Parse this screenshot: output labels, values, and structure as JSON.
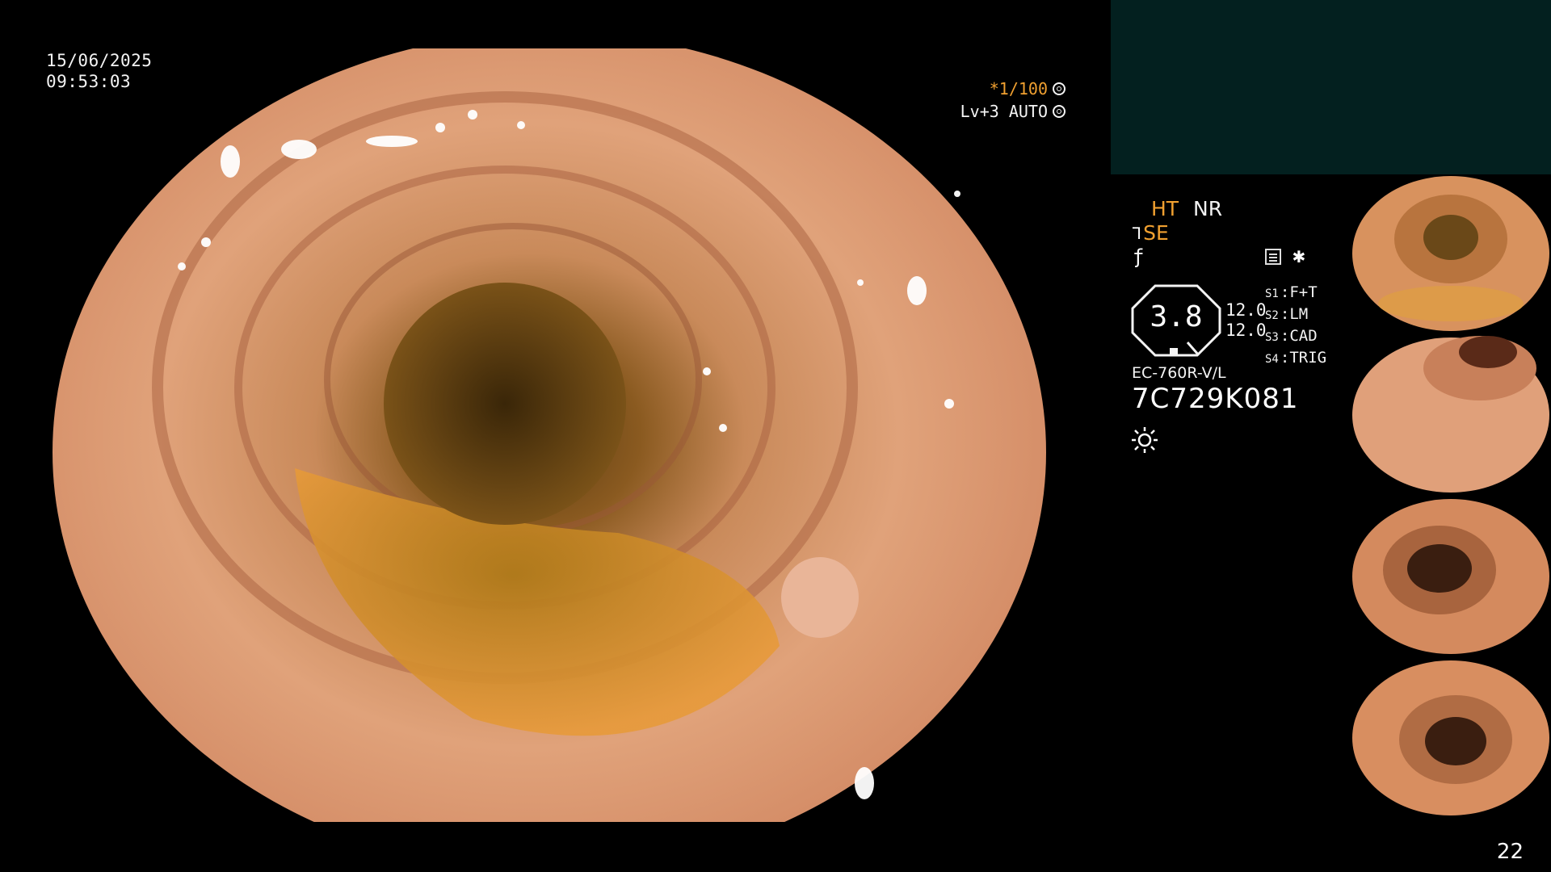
{
  "overlay": {
    "date": "15/06/2025",
    "time": "09:53:03",
    "shutter": "*1/100",
    "level": "Lv+3 AUTO"
  },
  "panel": {
    "ht": "HT",
    "nr": "NR",
    "se": "SE",
    "zoom": "3.8",
    "num1": "12.0",
    "num2": "12.0",
    "slots": [
      {
        "key": "S1",
        "value": "F+T"
      },
      {
        "key": "S2",
        "value": "LM"
      },
      {
        "key": "S3",
        "value": "CAD"
      },
      {
        "key": "S4",
        "value": "TRIG"
      }
    ],
    "scope_model": "EC-760R-V/L",
    "serial": "7C729K081"
  },
  "colors": {
    "accent": "#f0a030",
    "panel_teal": "#03201f"
  },
  "icons": [
    "aperture-icon",
    "iris-icon",
    "scope-icon",
    "curl-icon",
    "report-icon",
    "star-icon",
    "light-icon"
  ],
  "page_number": "22"
}
